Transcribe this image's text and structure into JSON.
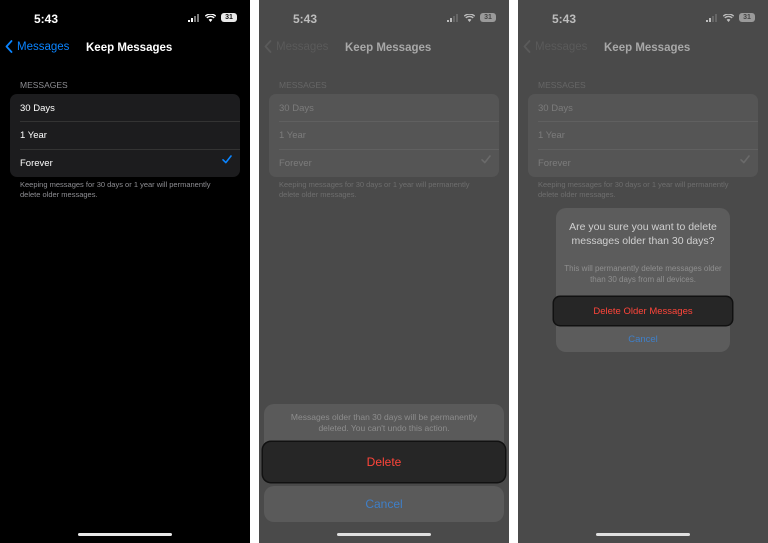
{
  "status": {
    "time": "5:43",
    "battery": "31"
  },
  "nav": {
    "back_label": "Messages",
    "title": "Keep Messages"
  },
  "section": {
    "header": "MESSAGES",
    "options": [
      "30 Days",
      "1 Year",
      "Forever"
    ],
    "selected": "Forever",
    "footnote": "Keeping messages for 30 days or 1 year will permanently delete older messages."
  },
  "action_sheet": {
    "message": "Messages older than 30 days will be permanently deleted. You can't undo this action.",
    "delete_label": "Delete",
    "cancel_label": "Cancel"
  },
  "alert": {
    "title": "Are you sure you want to delete messages older than 30 days?",
    "message": "This will permanently delete messages older than 30 days from all devices.",
    "delete_label": "Delete Older Messages",
    "cancel_label": "Cancel"
  },
  "colors": {
    "accent": "#0a84ff",
    "destructive": "#ff453a",
    "dim_overlay": "#4a4a4a"
  }
}
